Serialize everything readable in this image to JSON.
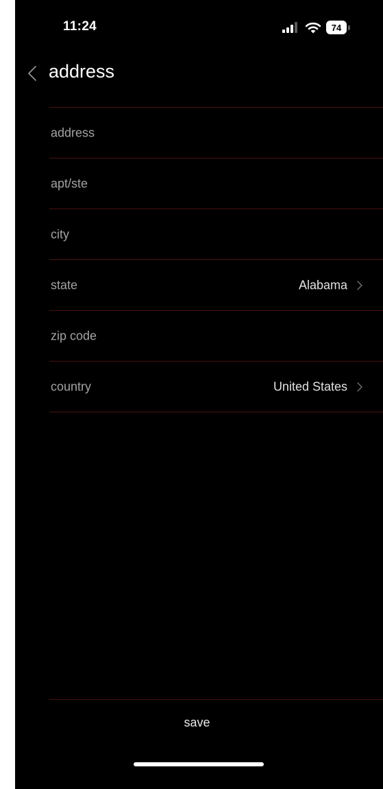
{
  "status_bar": {
    "time": "11:24",
    "battery_level": "74",
    "icons": [
      "signal-icon",
      "wifi-icon",
      "battery-icon"
    ]
  },
  "nav": {
    "back_icon": "chevron-left-icon",
    "title": "address"
  },
  "form": {
    "fields": [
      {
        "label": "address",
        "value": "",
        "type": "text"
      },
      {
        "label": "apt/ste",
        "value": "",
        "type": "text"
      },
      {
        "label": "city",
        "value": "",
        "type": "text"
      },
      {
        "label": "state",
        "value": "Alabama",
        "type": "select"
      },
      {
        "label": "zip code",
        "value": "",
        "type": "text"
      },
      {
        "label": "country",
        "value": "United States",
        "type": "select"
      }
    ]
  },
  "actions": {
    "save_label": "save"
  },
  "colors": {
    "background": "#000000",
    "divider": "#4a1212",
    "label": "#a3a3a3",
    "text": "#ffffff"
  }
}
